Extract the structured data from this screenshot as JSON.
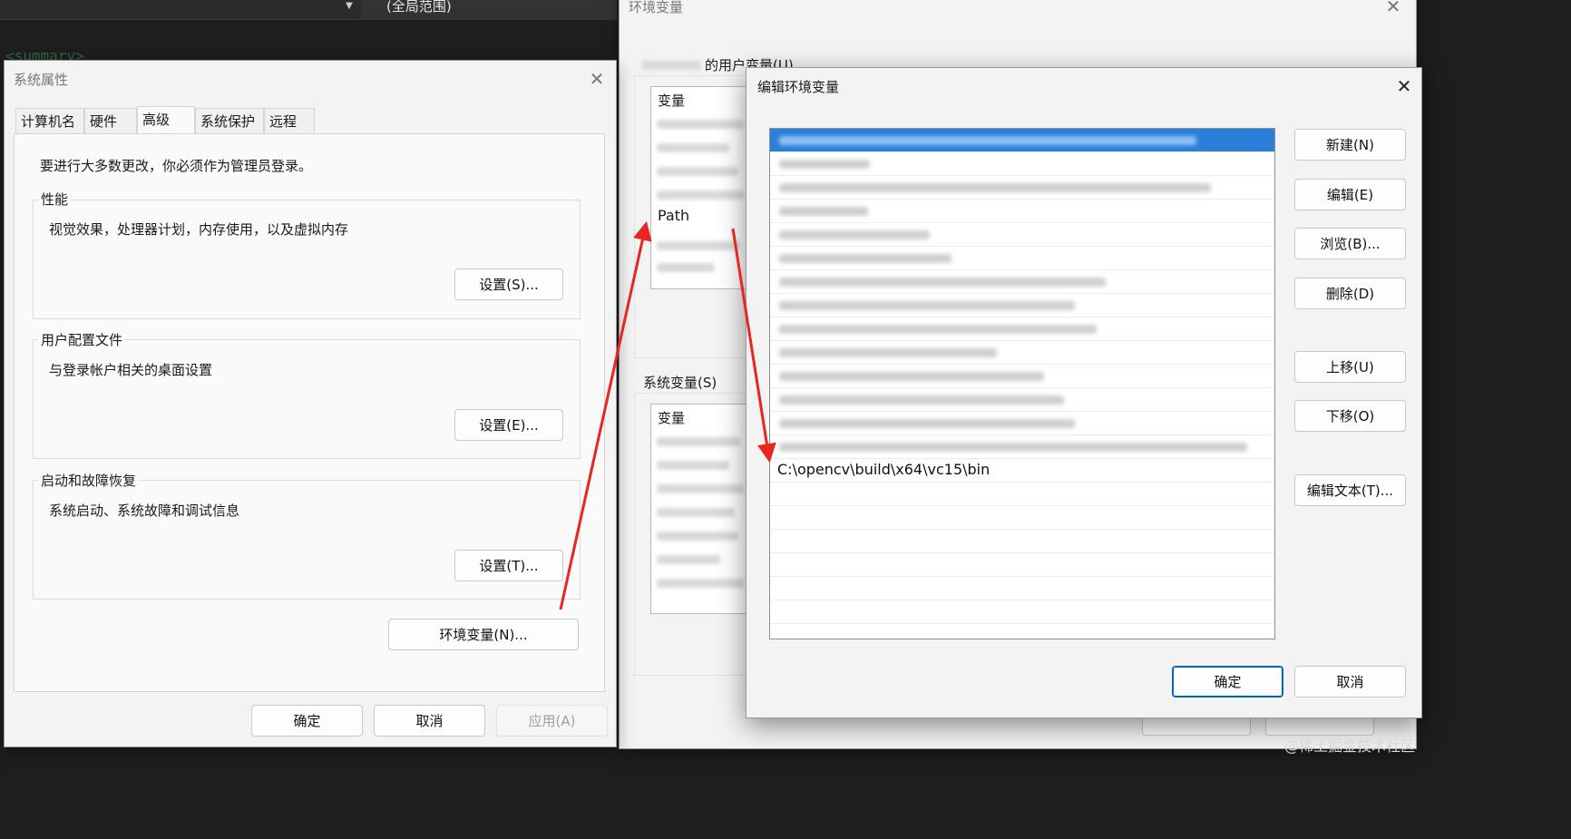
{
  "background": {
    "scope_label": "(全局范围)",
    "code_fragment": "<summary>"
  },
  "system_properties": {
    "title": "系统属性",
    "tabs": [
      {
        "label": "计算机名"
      },
      {
        "label": "硬件"
      },
      {
        "label": "高级"
      },
      {
        "label": "系统保护"
      },
      {
        "label": "远程"
      }
    ],
    "admin_notice": "要进行大多数更改，你必须作为管理员登录。",
    "performance": {
      "title": "性能",
      "description": "视觉效果，处理器计划，内存使用，以及虚拟内存",
      "button": "设置(S)..."
    },
    "user_profiles": {
      "title": "用户配置文件",
      "description": "与登录帐户相关的桌面设置",
      "button": "设置(E)..."
    },
    "startup_recovery": {
      "title": "启动和故障恢复",
      "description": "系统启动、系统故障和调试信息",
      "button": "设置(T)..."
    },
    "env_button": "环境变量(N)...",
    "ok": "确定",
    "cancel": "取消",
    "apply": "应用(A)"
  },
  "env_vars_window": {
    "title": "环境变量",
    "user_section_label": "的用户变量(U)",
    "user_col_header": "变量",
    "path_label": "Path",
    "system_section_label": "系统变量(S)",
    "system_col_header": "变量"
  },
  "edit_env_dialog": {
    "title": "编辑环境变量",
    "new_entry": "C:\\opencv\\build\\x64\\vc15\\bin",
    "buttons": {
      "new": "新建(N)",
      "edit": "编辑(E)",
      "browse": "浏览(B)...",
      "delete": "删除(D)",
      "move_up": "上移(U)",
      "move_down": "下移(O)",
      "edit_text": "编辑文本(T)..."
    },
    "ok": "确定",
    "cancel": "取消"
  },
  "watermark": "@稀土掘金技术社区",
  "colors": {
    "selection": "#2a7fd9",
    "arrow": "#e8251f",
    "primary_border": "#0067c0"
  }
}
